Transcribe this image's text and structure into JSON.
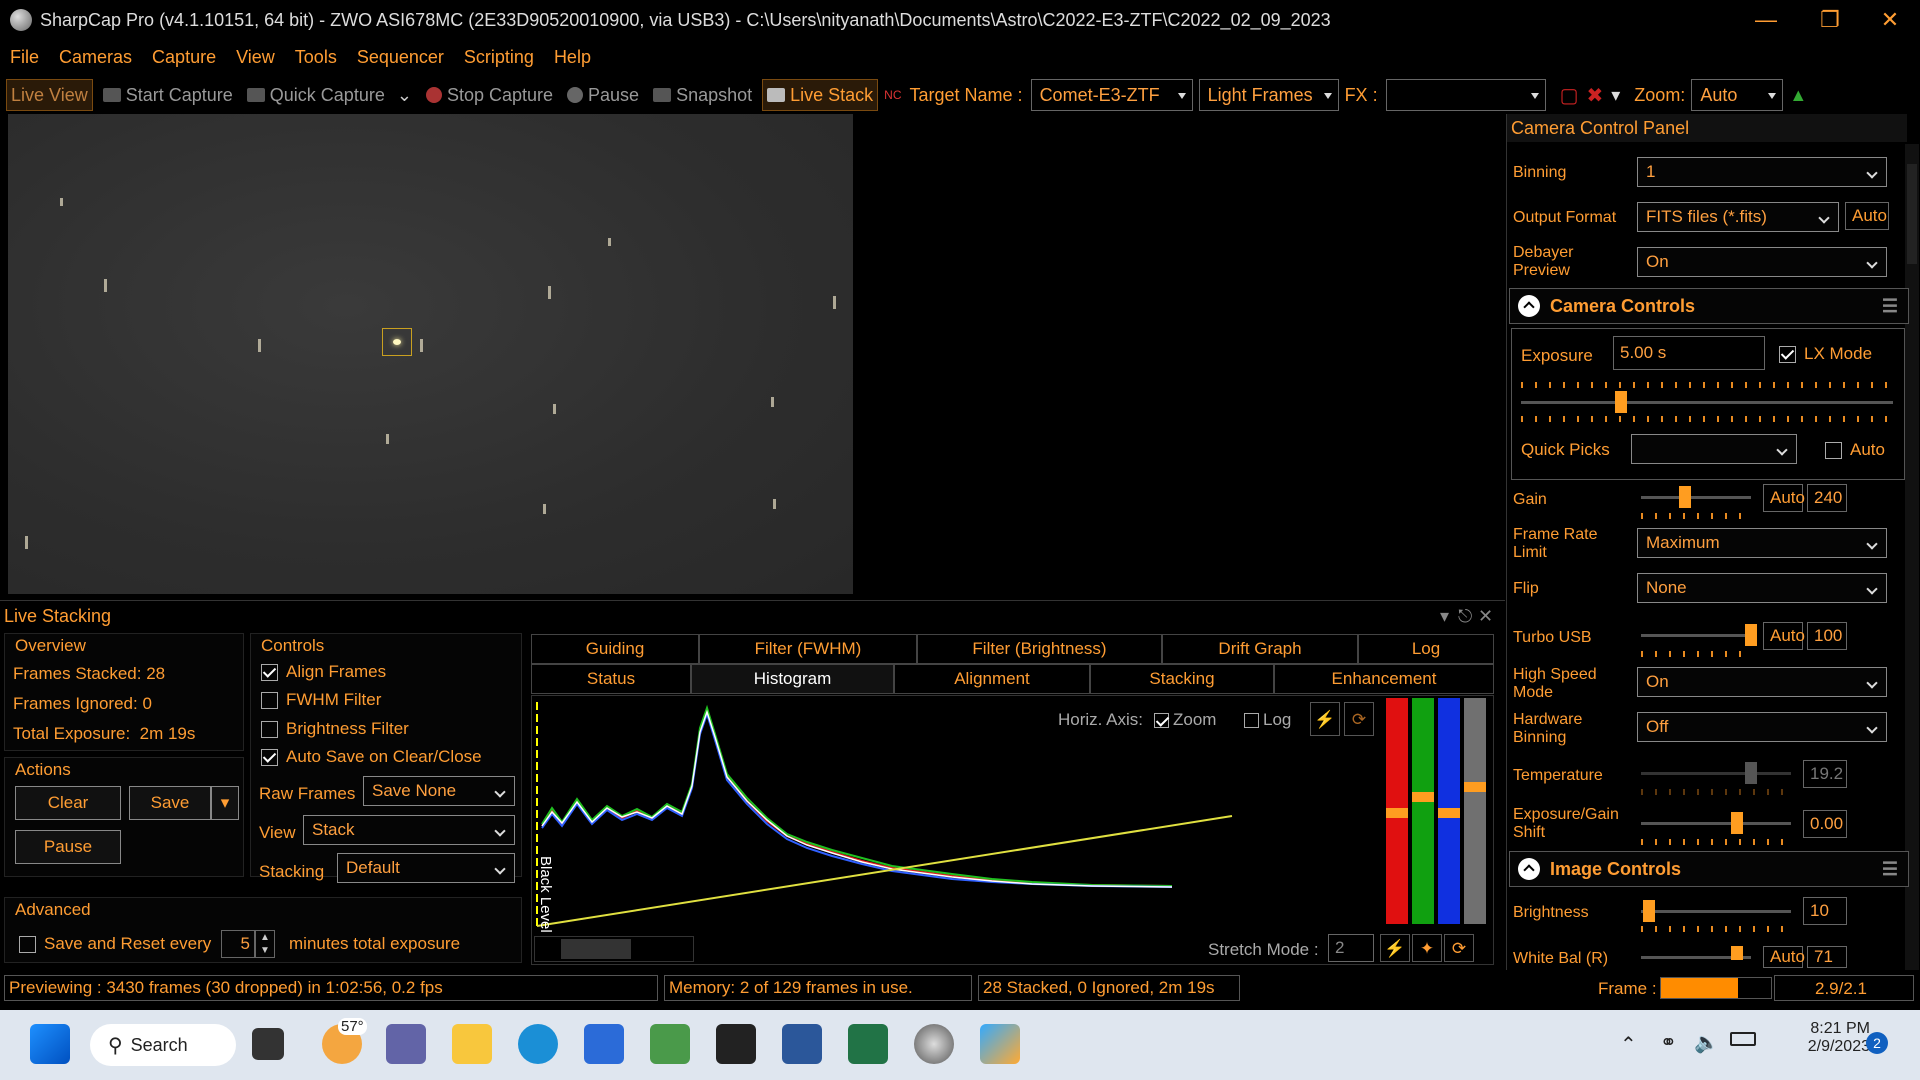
{
  "title": "SharpCap Pro (v4.1.10151, 64 bit) - ZWO ASI678MC (2E33D90520010900, via USB3) - C:\\Users\\nityanath\\Documents\\Astro\\C2022-E3-ZTF\\C2022_02_09_2023",
  "menu": [
    "File",
    "Cameras",
    "Capture",
    "View",
    "Tools",
    "Sequencer",
    "Scripting",
    "Help"
  ],
  "toolbar": {
    "live_view": "Live View",
    "start_capture": "Start Capture",
    "quick_capture": "Quick Capture",
    "stop_capture": "Stop Capture",
    "pause": "Pause",
    "snapshot": "Snapshot",
    "live_stack": "Live Stack",
    "target_label": "Target Name :",
    "target_value": "Comet-E3-ZTF",
    "frame_type": "Light Frames",
    "fx_label": "FX :",
    "fx_value": "",
    "zoom_label": "Zoom:",
    "zoom_value": "Auto"
  },
  "live_stacking": {
    "title": "Live Stacking",
    "overview": {
      "heading": "Overview",
      "frames_stacked": "Frames Stacked: 28",
      "frames_ignored": "Frames Ignored: 0",
      "total_exposure": "Total Exposure:  2m 19s"
    },
    "actions": {
      "heading": "Actions",
      "clear": "Clear",
      "save": "Save",
      "pause": "Pause"
    },
    "controls": {
      "heading": "Controls",
      "align": "Align Frames",
      "fwhm": "FWHM Filter",
      "brightness": "Brightness Filter",
      "autosave": "Auto Save on Clear/Close",
      "raw_frames_label": "Raw Frames",
      "raw_frames_value": "Save None",
      "view_label": "View",
      "view_value": "Stack",
      "stacking_label": "Stacking",
      "stacking_value": "Default"
    },
    "advanced": {
      "heading": "Advanced",
      "save_reset": "Save and Reset every",
      "minutes_value": "5",
      "minutes_suffix": "minutes total exposure"
    },
    "tabs_top": [
      "Guiding",
      "Filter (FWHM)",
      "Filter (Brightness)",
      "Drift Graph",
      "Log"
    ],
    "tabs_bottom": [
      "Status",
      "Histogram",
      "Alignment",
      "Stacking",
      "Enhancement"
    ],
    "histogram": {
      "horiz_axis": "Horiz. Axis:",
      "zoom": "Zoom",
      "log": "Log",
      "black_level": "Black Level",
      "stretch_mode": "Stretch Mode :",
      "stretch_value": "2"
    }
  },
  "ccp": {
    "title": "Camera Control Panel",
    "binning_label": "Binning",
    "binning_value": "1",
    "output_label": "Output Format",
    "output_value": "FITS files (*.fits)",
    "auto": "Auto",
    "debayer_label": "Debayer Preview",
    "debayer_value": "On",
    "camera_controls": "Camera Controls",
    "exposure_label": "Exposure",
    "exposure_value": "5.00 s",
    "lx_mode": "LX Mode",
    "quick_picks": "Quick Picks",
    "quick_auto": "Auto",
    "gain_label": "Gain",
    "gain_value": "240",
    "frame_rate_label": "Frame Rate Limit",
    "frame_rate_value": "Maximum",
    "flip_label": "Flip",
    "flip_value": "None",
    "turbo_label": "Turbo USB",
    "turbo_value": "100",
    "hsm_label": "High Speed Mode",
    "hsm_value": "On",
    "hwbin_label": "Hardware Binning",
    "hwbin_value": "Off",
    "temp_label": "Temperature",
    "temp_value": "19.2",
    "egs_label": "Exposure/Gain Shift",
    "egs_value": "0.00",
    "image_controls": "Image Controls",
    "brightness_label": "Brightness",
    "brightness_value": "10",
    "wb_label": "White Bal (R)",
    "wb_value": "71"
  },
  "status": {
    "preview": "Previewing : 3430 frames (30 dropped) in 1:02:56, 0.2 fps",
    "memory": "Memory: 2 of 129 frames in use.",
    "stacked": "28 Stacked, 0 Ignored, 2m 19s",
    "frame_label": "Frame :",
    "frame_ratio": "2.9/2.1"
  },
  "taskbar": {
    "search": "Search",
    "weather": "57°",
    "time": "8:21 PM",
    "date": "2/9/2023",
    "badge": "2"
  }
}
